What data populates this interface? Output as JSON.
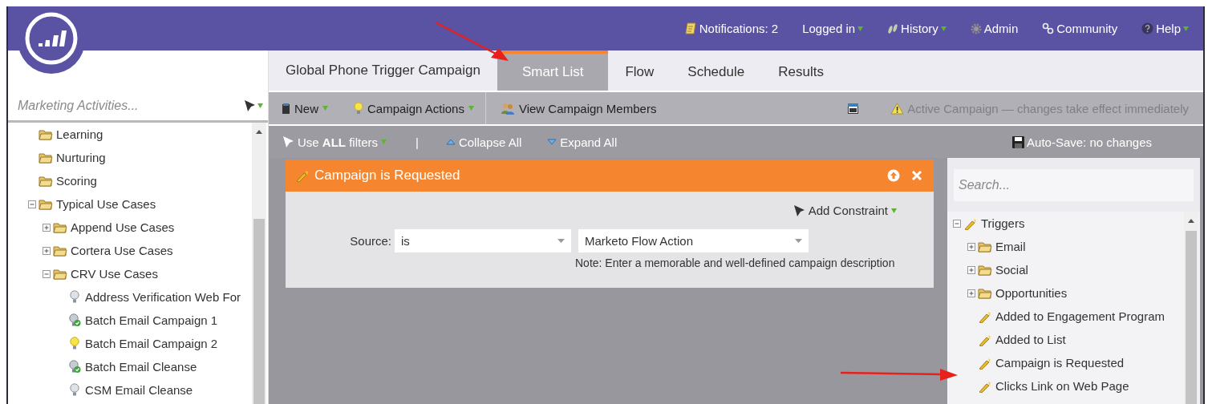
{
  "header": {
    "nav": [
      {
        "label": "Notifications: 2",
        "kind": "notes",
        "dropdown": false
      },
      {
        "label": "Logged in",
        "kind": "none",
        "dropdown": true
      },
      {
        "label": "History",
        "kind": "history",
        "dropdown": true
      },
      {
        "label": "Admin",
        "kind": "gear",
        "dropdown": false
      },
      {
        "label": "Community",
        "kind": "community",
        "dropdown": false
      },
      {
        "label": "Help",
        "kind": "help",
        "dropdown": true
      }
    ]
  },
  "sidebar": {
    "search": {
      "placeholder": "Marketing Activities..."
    },
    "tree": [
      {
        "label": "Learning",
        "kind": "folder"
      },
      {
        "label": "Nurturing",
        "kind": "folder"
      },
      {
        "label": "Scoring",
        "kind": "folder"
      },
      {
        "label": "Typical Use Cases",
        "kind": "folder",
        "expanded": true,
        "children": [
          {
            "label": "Append Use Cases",
            "kind": "folder",
            "expanded": false
          },
          {
            "label": "Cortera Use Cases",
            "kind": "folder",
            "expanded": false
          },
          {
            "label": "CRV Use Cases",
            "kind": "folder",
            "expanded": true,
            "children": [
              {
                "label": "Address Verification Web For",
                "kind": "campaign-inactive"
              },
              {
                "label": "Batch Email Campaign 1",
                "kind": "campaign-active"
              },
              {
                "label": "Batch Email Campaign 2",
                "kind": "campaign-on"
              },
              {
                "label": "Batch Email Cleanse",
                "kind": "campaign-active"
              },
              {
                "label": "CSM Email Cleanse",
                "kind": "campaign-inactive"
              }
            ]
          }
        ]
      }
    ]
  },
  "tabs": {
    "title": "Global Phone Trigger Campaign",
    "items": [
      {
        "label": "Smart List",
        "selected": true
      },
      {
        "label": "Flow",
        "selected": false
      },
      {
        "label": "Schedule",
        "selected": false
      },
      {
        "label": "Results",
        "selected": false
      }
    ]
  },
  "toolbar": {
    "buttons": [
      {
        "label": "New",
        "kind": "new",
        "dropdown": true
      },
      {
        "label": "Campaign Actions",
        "kind": "bulb",
        "dropdown": true
      },
      {
        "label": "View Campaign Members",
        "kind": "people",
        "dropdown": false
      }
    ],
    "notice": "Active Campaign — changes take effect immediately"
  },
  "filter_bar": {
    "use_filters": "Use **ALL** filters",
    "separator": "|",
    "collapse": "Collapse All",
    "expand": "Expand All",
    "autosave": "Auto-Save: no changes"
  },
  "filter": {
    "title": "Campaign is Requested",
    "add_constraint": "Add Constraint",
    "rows": [
      {
        "label": "Source:",
        "operator": "is",
        "value": "Marketo Flow Action",
        "note": "Note: Enter a memorable and well-defined campaign description"
      }
    ]
  },
  "trigger_panel": {
    "search": {
      "placeholder": "Search..."
    },
    "tree": [
      {
        "label": "Triggers",
        "kind": "trigger",
        "expanded": true,
        "children": [
          {
            "label": "Email",
            "kind": "folder",
            "expanded": false
          },
          {
            "label": "Social",
            "kind": "folder",
            "expanded": false
          },
          {
            "label": "Opportunities",
            "kind": "folder",
            "expanded": false
          },
          {
            "label": "Added to Engagement Program",
            "kind": "trigger"
          },
          {
            "label": "Added to List",
            "kind": "trigger"
          },
          {
            "label": "Campaign is Requested",
            "kind": "trigger"
          },
          {
            "label": "Clicks Link on Web Page",
            "kind": "trigger"
          }
        ]
      }
    ]
  }
}
